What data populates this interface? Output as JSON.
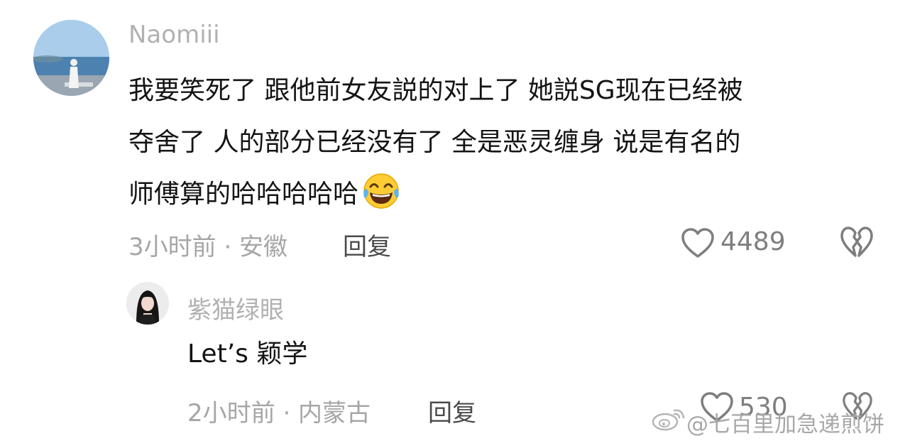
{
  "comment": {
    "username": "Naomiii",
    "lines": [
      "我要笑死了 跟他前女友説的对上了 她説SG现在已经被",
      "夺舍了 人的部分已经没有了 全是恶灵缠身 说是有名的",
      "师傅算的哈哈哈哈哈"
    ],
    "emoji": "😂",
    "time_location": "3小时前 · 安徽",
    "reply_label": "回复",
    "like_count": "4489"
  },
  "reply": {
    "username": "紫猫绿眼",
    "text": "Let’s 颖学",
    "time_location": "2小时前 · 内蒙古",
    "reply_label": "回复",
    "like_count": "530"
  },
  "watermark": {
    "text": "@七百里加急递煎饼"
  },
  "icons": {
    "like": "heart-outline-icon",
    "dislike": "broken-heart-icon",
    "weibo": "weibo-logo-icon"
  }
}
